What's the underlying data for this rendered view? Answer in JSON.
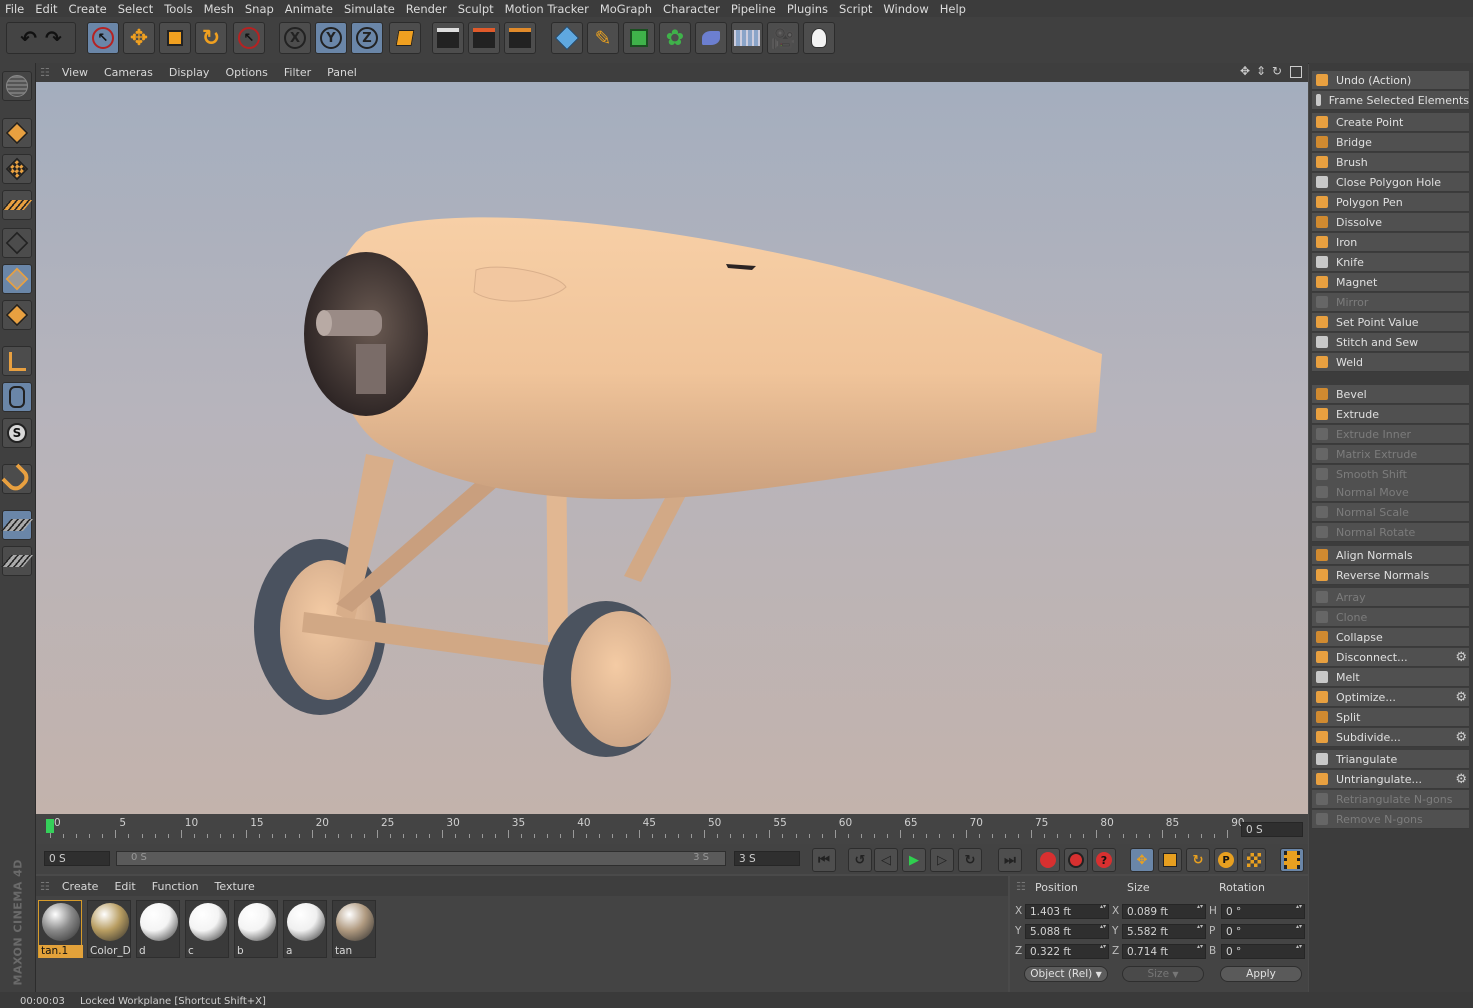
{
  "menu": [
    "File",
    "Edit",
    "Create",
    "Select",
    "Tools",
    "Mesh",
    "Snap",
    "Animate",
    "Simulate",
    "Render",
    "Sculpt",
    "Motion Tracker",
    "MoGraph",
    "Character",
    "Pipeline",
    "Plugins",
    "Script",
    "Window",
    "Help"
  ],
  "toolbar": {
    "axis_x": "X",
    "axis_y": "Y",
    "axis_z": "Z"
  },
  "viewport_menu": [
    "View",
    "Cameras",
    "Display",
    "Options",
    "Filter",
    "Panel"
  ],
  "commands": [
    {
      "label": "Undo (Action)",
      "enabled": true,
      "gear": false,
      "icon": "undo-icon"
    },
    {
      "label": "Frame Selected Elements",
      "enabled": true,
      "gear": false,
      "icon": "frame-icon"
    },
    {
      "label": "Create Point",
      "enabled": true,
      "gear": false,
      "icon": "create-point-icon"
    },
    {
      "label": "Bridge",
      "enabled": true,
      "gear": false,
      "icon": "bridge-icon"
    },
    {
      "label": "Brush",
      "enabled": true,
      "gear": false,
      "icon": "brush-icon"
    },
    {
      "label": "Close Polygon Hole",
      "enabled": true,
      "gear": false,
      "icon": "close-hole-icon"
    },
    {
      "label": "Polygon Pen",
      "enabled": true,
      "gear": false,
      "icon": "polygon-pen-icon"
    },
    {
      "label": "Dissolve",
      "enabled": true,
      "gear": false,
      "icon": "dissolve-icon"
    },
    {
      "label": "Iron",
      "enabled": true,
      "gear": false,
      "icon": "iron-icon"
    },
    {
      "label": "Knife",
      "enabled": true,
      "gear": false,
      "icon": "knife-icon"
    },
    {
      "label": "Magnet",
      "enabled": true,
      "gear": false,
      "icon": "magnet-icon"
    },
    {
      "label": "Mirror",
      "enabled": false,
      "gear": false,
      "icon": "mirror-icon"
    },
    {
      "label": "Set Point Value",
      "enabled": true,
      "gear": false,
      "icon": "set-point-icon"
    },
    {
      "label": "Stitch and Sew",
      "enabled": true,
      "gear": false,
      "icon": "stitch-icon"
    },
    {
      "label": "Weld",
      "enabled": true,
      "gear": false,
      "icon": "weld-icon"
    },
    {
      "label": "Bevel",
      "enabled": true,
      "gear": false,
      "icon": "bevel-icon"
    },
    {
      "label": "Extrude",
      "enabled": true,
      "gear": false,
      "icon": "extrude-icon"
    },
    {
      "label": "Extrude Inner",
      "enabled": false,
      "gear": false,
      "icon": "extrude-inner-icon"
    },
    {
      "label": "Matrix Extrude",
      "enabled": false,
      "gear": false,
      "icon": "matrix-extrude-icon"
    },
    {
      "label": "Smooth Shift",
      "enabled": false,
      "gear": false,
      "icon": "smooth-shift-icon"
    },
    {
      "label": "Normal Move",
      "enabled": false,
      "gear": false,
      "icon": "normal-move-icon"
    },
    {
      "label": "Normal Scale",
      "enabled": false,
      "gear": false,
      "icon": "normal-scale-icon"
    },
    {
      "label": "Normal Rotate",
      "enabled": false,
      "gear": false,
      "icon": "normal-rotate-icon"
    },
    {
      "label": "Align Normals",
      "enabled": true,
      "gear": false,
      "icon": "align-normals-icon"
    },
    {
      "label": "Reverse Normals",
      "enabled": true,
      "gear": false,
      "icon": "reverse-normals-icon"
    },
    {
      "label": "Array",
      "enabled": false,
      "gear": false,
      "icon": "array-icon"
    },
    {
      "label": "Clone",
      "enabled": false,
      "gear": false,
      "icon": "clone-icon"
    },
    {
      "label": "Collapse",
      "enabled": true,
      "gear": false,
      "icon": "collapse-icon"
    },
    {
      "label": "Disconnect...",
      "enabled": true,
      "gear": true,
      "icon": "disconnect-icon"
    },
    {
      "label": "Melt",
      "enabled": true,
      "gear": false,
      "icon": "melt-icon"
    },
    {
      "label": "Optimize...",
      "enabled": true,
      "gear": true,
      "icon": "optimize-icon"
    },
    {
      "label": "Split",
      "enabled": true,
      "gear": false,
      "icon": "split-icon"
    },
    {
      "label": "Subdivide...",
      "enabled": true,
      "gear": true,
      "icon": "subdivide-icon"
    },
    {
      "label": "Triangulate",
      "enabled": true,
      "gear": false,
      "icon": "triangulate-icon"
    },
    {
      "label": "Untriangulate...",
      "enabled": true,
      "gear": true,
      "icon": "untriangulate-icon"
    },
    {
      "label": "Retriangulate N-gons",
      "enabled": false,
      "gear": false,
      "icon": "retriangulate-icon"
    },
    {
      "label": "Remove N-gons",
      "enabled": false,
      "gear": false,
      "icon": "remove-ngons-icon"
    }
  ],
  "timeline": {
    "ticks": [
      "0",
      "5",
      "10",
      "15",
      "20",
      "25",
      "30",
      "35",
      "40",
      "45",
      "50",
      "55",
      "60",
      "65",
      "70",
      "75",
      "80",
      "85",
      "90"
    ],
    "current_frame": "0 S",
    "range_start": "0 S",
    "range_bar_start": "0 S",
    "range_bar_end": "3 S",
    "range_end": "3 S"
  },
  "material_menu": [
    "Create",
    "Edit",
    "Function",
    "Texture"
  ],
  "materials": [
    {
      "name": "tan.1",
      "selected": true,
      "color": "#8a8a8a"
    },
    {
      "name": "Color_D",
      "selected": false,
      "color": "#b89d61"
    },
    {
      "name": "d",
      "selected": false,
      "color": "#f4f4f4"
    },
    {
      "name": "c",
      "selected": false,
      "color": "#f4f4f4"
    },
    {
      "name": "b",
      "selected": false,
      "color": "#f4f4f4"
    },
    {
      "name": "a",
      "selected": false,
      "color": "#f0f0f0"
    },
    {
      "name": "tan",
      "selected": false,
      "color": "#b09a80"
    }
  ],
  "coords": {
    "headers": {
      "position": "Position",
      "size": "Size",
      "rotation": "Rotation"
    },
    "rows": [
      {
        "axis": "X",
        "position": "1.403 ft",
        "size_axis": "X",
        "size": "0.089 ft",
        "rot_axis": "H",
        "rotation": "0 °"
      },
      {
        "axis": "Y",
        "position": "5.088 ft",
        "size_axis": "Y",
        "size": "5.582 ft",
        "rot_axis": "P",
        "rotation": "0 °"
      },
      {
        "axis": "Z",
        "position": "0.322 ft",
        "size_axis": "Z",
        "size": "0.714 ft",
        "rot_axis": "B",
        "rotation": "0 °"
      }
    ],
    "mode": "Object (Rel)",
    "size_mode": "Size",
    "apply": "Apply"
  },
  "brand": "MAXON CINEMA 4D",
  "status": {
    "time": "00:00:03",
    "message": "Locked Workplane [Shortcut Shift+X]"
  },
  "colors": {
    "accent": "#e3a23a",
    "selected": "#6a86a8",
    "model": "#f3c9a1"
  }
}
